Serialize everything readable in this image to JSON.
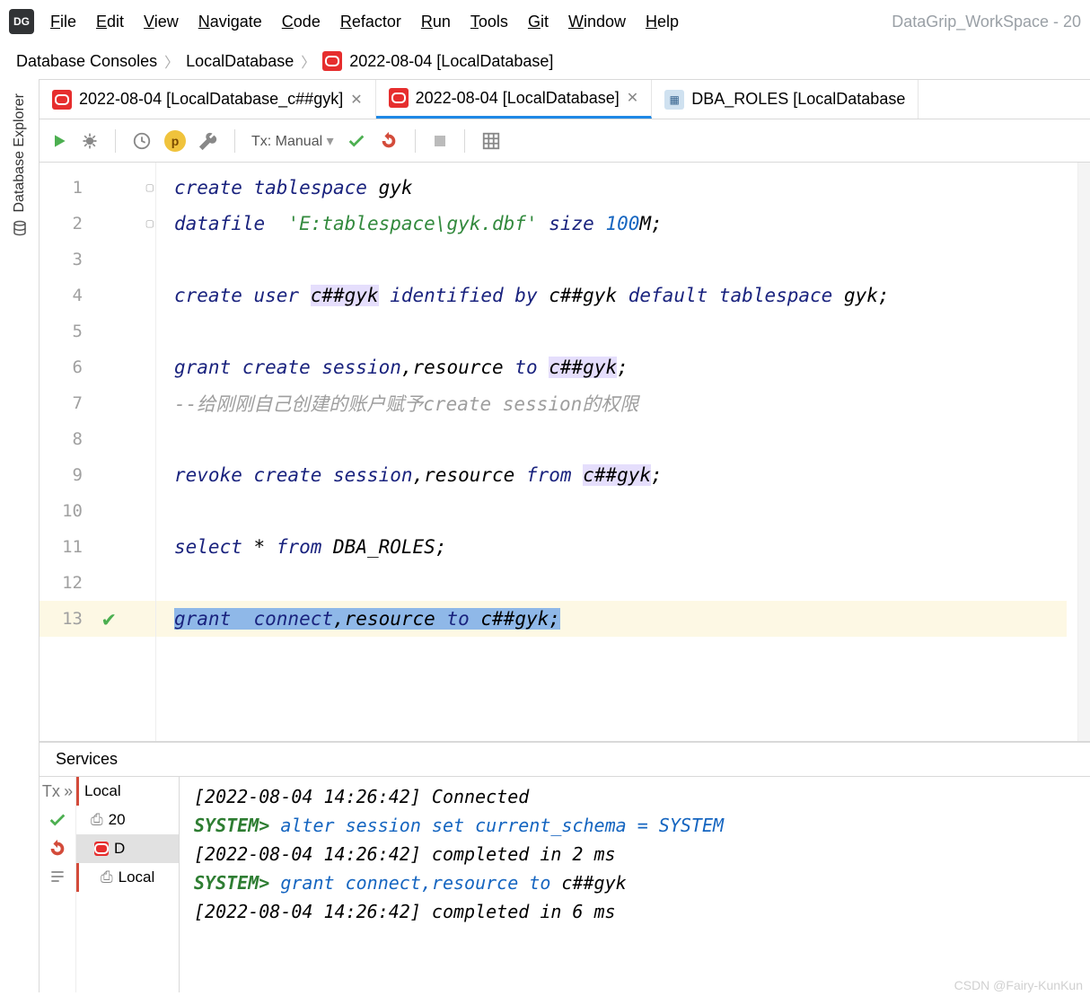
{
  "workspace_title": "DataGrip_WorkSpace - 20",
  "menu": [
    "File",
    "Edit",
    "View",
    "Navigate",
    "Code",
    "Refactor",
    "Run",
    "Tools",
    "Git",
    "Window",
    "Help"
  ],
  "breadcrumb": {
    "a": "Database Consoles",
    "b": "LocalDatabase",
    "c": "2022-08-04 [LocalDatabase]"
  },
  "sidebar": {
    "label": "Database Explorer"
  },
  "tabs": [
    {
      "label": "2022-08-04 [LocalDatabase_c##gyk]",
      "icon": "oracle",
      "closable": true,
      "active": false
    },
    {
      "label": "2022-08-04 [LocalDatabase]",
      "icon": "oracle",
      "closable": true,
      "active": true
    },
    {
      "label": "DBA_ROLES [LocalDatabase",
      "icon": "table",
      "closable": false,
      "active": false
    }
  ],
  "toolbar": {
    "tx_label": "Tx: Manual"
  },
  "editor": {
    "lines": [
      {
        "n": 1,
        "fold": true,
        "tokens": [
          {
            "c": "kw",
            "t": "create tablespace "
          },
          {
            "c": "id",
            "t": "gyk"
          }
        ]
      },
      {
        "n": 2,
        "fold": true,
        "tokens": [
          {
            "c": "kw",
            "t": "datafile  "
          },
          {
            "c": "str",
            "t": "'E:tablespace\\gyk.dbf'"
          },
          {
            "c": "kw",
            "t": " size "
          },
          {
            "c": "num",
            "t": "100"
          },
          {
            "c": "id",
            "t": "M;"
          }
        ]
      },
      {
        "n": 3,
        "tokens": []
      },
      {
        "n": 4,
        "tokens": [
          {
            "c": "kw",
            "t": "create user "
          },
          {
            "c": "id hl",
            "t": "c##gyk"
          },
          {
            "c": "kw",
            "t": " identified by "
          },
          {
            "c": "id",
            "t": "c##gyk "
          },
          {
            "c": "kw",
            "t": "default tablespace "
          },
          {
            "c": "id",
            "t": "gyk;"
          }
        ]
      },
      {
        "n": 5,
        "tokens": []
      },
      {
        "n": 6,
        "tokens": [
          {
            "c": "kw",
            "t": "grant create session"
          },
          {
            "c": "id",
            "t": ",resource "
          },
          {
            "c": "kw",
            "t": "to "
          },
          {
            "c": "id hl",
            "t": "c##gyk"
          },
          {
            "c": "id",
            "t": ";"
          }
        ]
      },
      {
        "n": 7,
        "tokens": [
          {
            "c": "cmt",
            "t": "--给刚刚自己创建的账户赋予create session的权限"
          }
        ]
      },
      {
        "n": 8,
        "tokens": []
      },
      {
        "n": 9,
        "tokens": [
          {
            "c": "kw",
            "t": "revoke create session"
          },
          {
            "c": "id",
            "t": ",resource "
          },
          {
            "c": "kw",
            "t": "from "
          },
          {
            "c": "id hl",
            "t": "c##gyk"
          },
          {
            "c": "id",
            "t": ";"
          }
        ]
      },
      {
        "n": 10,
        "tokens": []
      },
      {
        "n": 11,
        "tokens": [
          {
            "c": "kw",
            "t": "select "
          },
          {
            "c": "id",
            "t": "* "
          },
          {
            "c": "kw",
            "t": "from "
          },
          {
            "c": "id",
            "t": "DBA_ROLES;"
          }
        ]
      },
      {
        "n": 12,
        "tokens": []
      },
      {
        "n": 13,
        "current": true,
        "check": true,
        "tokens": [
          {
            "c": "kw sel",
            "t": "grant  connect"
          },
          {
            "c": "id sel",
            "t": ",resource "
          },
          {
            "c": "kw sel",
            "t": "to "
          },
          {
            "c": "id sel-end",
            "t": "c##gyk;"
          }
        ]
      }
    ]
  },
  "services": {
    "title": "Services",
    "tx_label": "Tx",
    "more": "»",
    "tree": [
      "Local",
      "20",
      "D",
      "Local"
    ],
    "log": [
      {
        "type": "plain",
        "text": "[2022-08-04 14:26:42] Connected"
      },
      {
        "type": "sql",
        "prompt": "SYSTEM>",
        "sql": " alter session set current_schema = SYSTEM"
      },
      {
        "type": "plain",
        "text": "[2022-08-04 14:26:42] completed in 2 ms"
      },
      {
        "type": "sql",
        "prompt": "SYSTEM>",
        "sql_lead": " grant  connect,resource to ",
        "sql_tail": "c##gyk"
      },
      {
        "type": "plain",
        "text": "[2022-08-04 14:26:42] completed in 6 ms"
      }
    ]
  },
  "watermark": "CSDN @Fairy-KunKun"
}
